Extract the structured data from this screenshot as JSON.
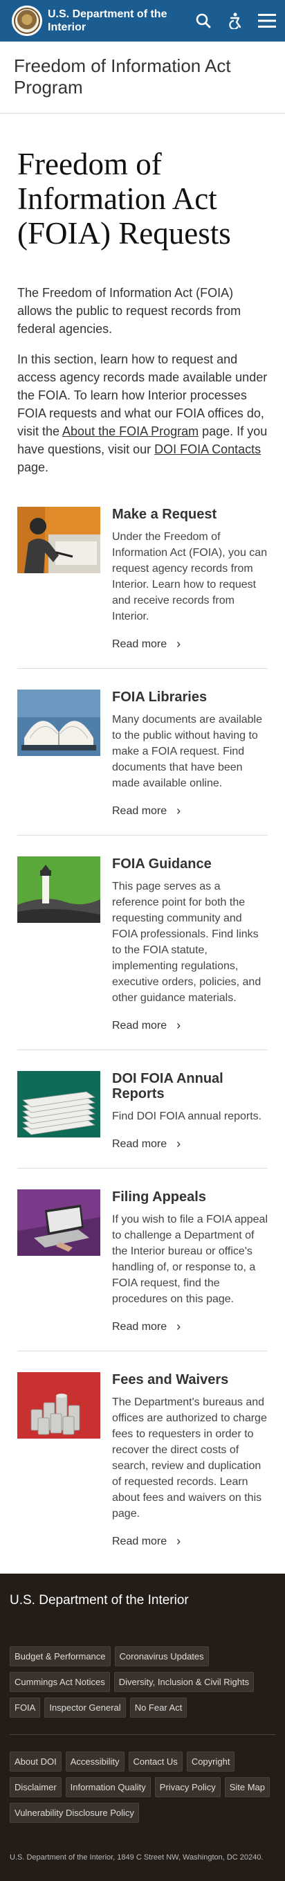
{
  "header": {
    "site_name": "U.S. Department of the Interior"
  },
  "program": {
    "title": "Freedom of Information Act Program"
  },
  "hero": {
    "title": "Freedom of Information Act (FOIA) Requests",
    "intro1": "The Freedom of Information Act (FOIA) allows the public to request records from federal agencies.",
    "intro2_pre": "In this section, learn how to request and access agency records made available under the FOIA. To learn how Interior processes FOIA requests and what our FOIA offices do, visit the ",
    "intro2_link1": "About the FOIA Program",
    "intro2_mid": " page. If you have questions, visit our ",
    "intro2_link2": "DOI FOIA Contacts",
    "intro2_post": " page."
  },
  "cards": [
    {
      "title": "Make a Request",
      "desc": "Under the Freedom of Information Act (FOIA), you can request agency records from Interior. Learn how to request and receive records from Interior.",
      "link": "Read more"
    },
    {
      "title": "FOIA Libraries",
      "desc": "Many documents are available to the public without having to make a FOIA request. Find documents that have been made available online.",
      "link": "Read more"
    },
    {
      "title": "FOIA Guidance",
      "desc": "This page serves as a reference point for both the requesting community and FOIA professionals. Find links to the FOIA statute, implementing regulations, executive orders, policies, and other guidance materials.",
      "link": "Read more"
    },
    {
      "title": "DOI FOIA Annual Reports",
      "desc": "Find DOI FOIA annual reports.",
      "link": "Read more"
    },
    {
      "title": "Filing Appeals",
      "desc": "If you wish to file a FOIA appeal to challenge a Department of the Interior bureau or office's handling of, or response to, a FOIA request, find the procedures on this page.",
      "link": "Read more"
    },
    {
      "title": "Fees and Waivers",
      "desc": "The Department's bureaus and offices are authorized to charge fees to requesters in order to recover the direct costs of search, review and duplication of requested records. Learn about fees and waivers on this page.",
      "link": "Read more"
    }
  ],
  "footer": {
    "title": "U.S. Department of the Interior",
    "links_primary": [
      "Budget & Performance",
      "Coronavirus Updates",
      "Cummings Act Notices",
      "Diversity, Inclusion & Civil Rights",
      "FOIA",
      "Inspector General",
      "No Fear Act"
    ],
    "links_secondary": [
      "About DOI",
      "Accessibility",
      "Contact Us",
      "Copyright",
      "Disclaimer",
      "Information Quality",
      "Privacy Policy",
      "Site Map",
      "Vulnerability Disclosure Policy"
    ],
    "address": "U.S. Department of the Interior, 1849 C Street NW, Washington, DC 20240."
  },
  "colors": {
    "header_bg": "#1b5c91",
    "footer_bg": "#231c17"
  }
}
